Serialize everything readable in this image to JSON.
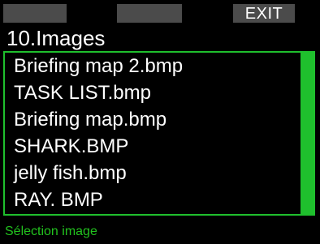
{
  "softkeys": {
    "left": "",
    "middle": "",
    "right": "EXIT"
  },
  "screen": {
    "title": "10.Images"
  },
  "images_list": {
    "items": [
      "Briefing map 2.bmp",
      "TASK LIST.bmp",
      "Briefing map.bmp",
      "SHARK.BMP",
      "jelly fish.bmp",
      "RAY. BMP"
    ],
    "scroll_fraction": 1.0
  },
  "status": {
    "text": "Sélection image"
  },
  "colors": {
    "accent": "#1fbf2d",
    "status_text": "#22c21e",
    "softkey_bg": "#4b4b4b",
    "background": "#000000",
    "text": "#ffffff"
  }
}
